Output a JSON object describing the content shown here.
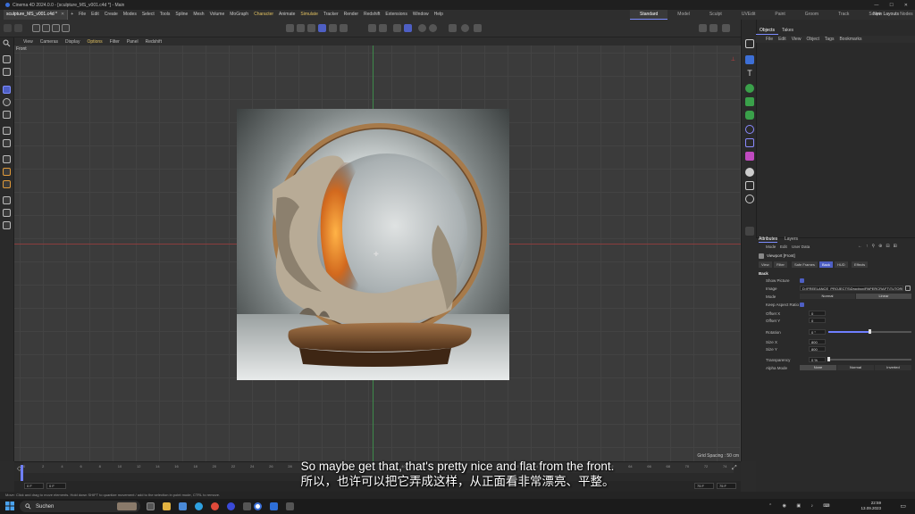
{
  "window": {
    "title": "Cinema 4D 2024.0.0 - [sculpture_MS_v001.c4d *] - Main"
  },
  "tabs": [
    {
      "label": "sculpture_MS_v001.c4d *",
      "active": true
    },
    {
      "label": "+",
      "active": false
    }
  ],
  "menus": [
    "File",
    "Edit",
    "Create",
    "Modes",
    "Select",
    "Tools",
    "Spline",
    "Mesh",
    "Volume",
    "MoGraph",
    "Character",
    "Animate",
    "Simulate",
    "Tracker",
    "Render",
    "Redshift",
    "Extensions",
    "Window",
    "Help"
  ],
  "layouts": {
    "items": [
      "Standard",
      "Model",
      "Sculpt",
      "UVEdit",
      "Paint",
      "Groom",
      "Track",
      "Script",
      "Nodes"
    ],
    "selected": "Standard",
    "new_layouts": "New Layouts"
  },
  "viewport": {
    "menu": [
      "View",
      "Cameras",
      "Display",
      "Options",
      "Filter",
      "Panel",
      "Redshift"
    ],
    "label": "Front",
    "grid_spacing": "Grid Spacing : 50 cm"
  },
  "objects_panel": {
    "tabs": [
      "Objects",
      "Takes"
    ],
    "menu": [
      "File",
      "Edit",
      "View",
      "Object",
      "Tags",
      "Bookmarks"
    ]
  },
  "attributes_panel": {
    "tabs": [
      "Attributes",
      "Layers"
    ],
    "menu": [
      "Mode",
      "Edit",
      "User Data"
    ],
    "object": "Viewport [Front]",
    "buttons": [
      "View",
      "Filter",
      "Safe Frames",
      "Back",
      "HUD",
      "Effects"
    ],
    "selected_button": "Back",
    "section": "Back",
    "rows": {
      "show_picture": "Show Picture",
      "image": "Image",
      "image_value": "D:\\FREELANCE_PROJECTS\\Dropbox\\PAPERCRAFT\\TUTORIALS",
      "mode": "Mode",
      "mode_options": [
        "Normal",
        "Linear"
      ],
      "keep_aspect": "Keep Aspect Ratio",
      "offset_x": "Offset X",
      "offset_x_val": "0",
      "offset_y": "Offset Y",
      "offset_y_val": "0",
      "rotation": "Rotation",
      "rotation_val": "0 °",
      "size_x": "Size X",
      "size_x_val": "800",
      "size_y": "Size Y",
      "size_y_val": "800",
      "transparency": "Transparency",
      "transparency_val": "0 %",
      "alpha_mode": "Alpha Mode",
      "alpha_options": [
        "None",
        "Normal",
        "Inverted"
      ]
    }
  },
  "timeline": {
    "ticks": [
      "0",
      "2",
      "4",
      "6",
      "8",
      "10",
      "12",
      "14",
      "16",
      "18",
      "20",
      "22",
      "24",
      "26",
      "28",
      "30",
      "32",
      "34",
      "36",
      "38",
      "40",
      "42",
      "44",
      "46",
      "48",
      "50",
      "52",
      "54",
      "56",
      "58",
      "60",
      "62",
      "64",
      "66",
      "68",
      "70",
      "72",
      "74"
    ],
    "start_field": "0 F",
    "start_field2": "0 F",
    "end_field": "75 F",
    "end_field2": "75 F"
  },
  "status_text": "Move: Click and drag to move elements. Hold down SHIFT to quantize movement / add to the selection in point mode, CTRL to remove.",
  "subtitles": {
    "english": "So maybe get that, that's pretty nice and flat from the front.",
    "chinese": "所以，也许可以把它弄成这样，从正面看非常漂亮、平整。"
  },
  "taskbar": {
    "search_placeholder": "Suchen",
    "time": "22:59",
    "date": "13.09.2023"
  },
  "colors": {
    "accent": "#4e5fc4",
    "menu_highlight": "#e0c060"
  }
}
